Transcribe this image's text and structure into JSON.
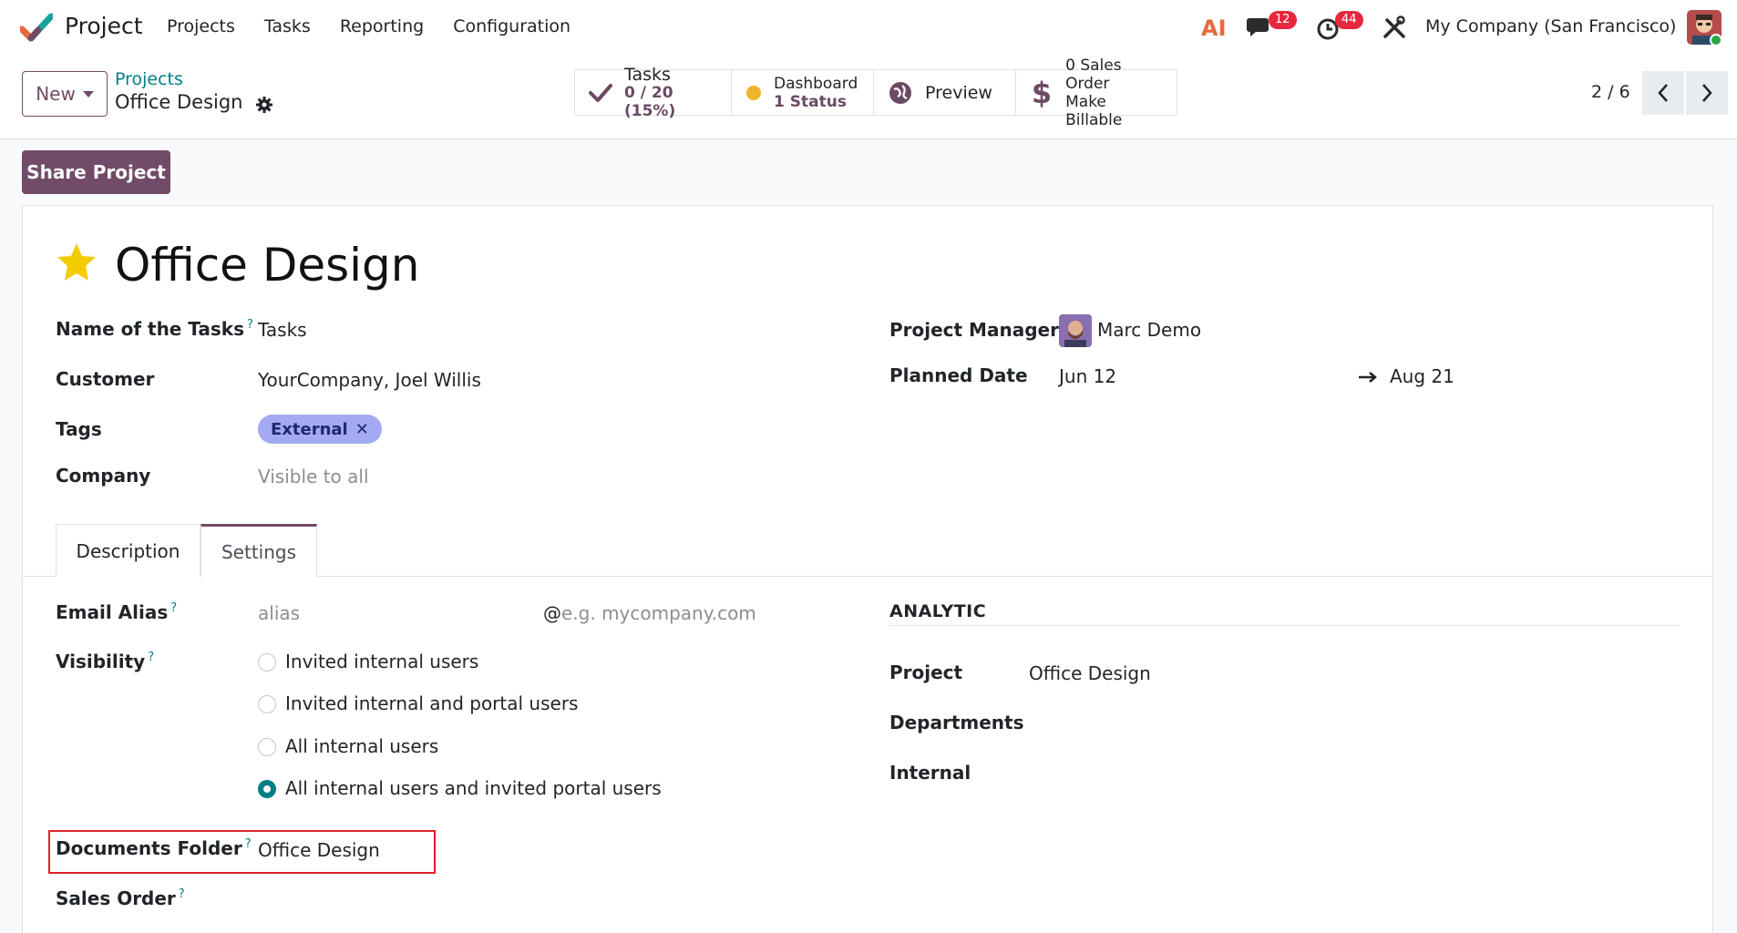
{
  "navbar": {
    "app_name": "Project",
    "menu": [
      "Projects",
      "Tasks",
      "Reporting",
      "Configuration"
    ],
    "ai_label": "AI",
    "messages_count": "12",
    "activities_count": "44",
    "company": "My Company (San Francisco)"
  },
  "control_panel": {
    "new_label": "New",
    "breadcrumb_parent": "Projects",
    "breadcrumb_current": "Office Design",
    "smart_buttons": {
      "tasks_title": "Tasks",
      "tasks_value": "0 / 20 (15%)",
      "dashboard_title": "Dashboard",
      "dashboard_value": "1 Status",
      "preview_title": "Preview",
      "sales_title": "0 Sales Order",
      "sales_value": "Make Billable"
    },
    "pager": "2 / 6"
  },
  "share_button": "Share Project",
  "record": {
    "title": "Office Design",
    "fields": {
      "name_of_tasks_label": "Name of the Tasks",
      "name_of_tasks_value": "Tasks",
      "customer_label": "Customer",
      "customer_value": "YourCompany, Joel Willis",
      "tags_label": "Tags",
      "tag_external": "External",
      "company_label": "Company",
      "company_placeholder": "Visible to all",
      "manager_label": "Project Manager",
      "manager_value": "Marc Demo",
      "planned_label": "Planned Date",
      "planned_start": "Jun 12",
      "planned_end": "Aug 21"
    }
  },
  "tabs": {
    "description": "Description",
    "settings": "Settings"
  },
  "settings": {
    "email_alias_label": "Email Alias",
    "alias_placeholder": "alias",
    "domain_at": "@",
    "domain_placeholder": "e.g. mycompany.com",
    "visibility_label": "Visibility",
    "visibility_options": [
      "Invited internal users",
      "Invited internal and portal users",
      "All internal users",
      "All internal users and invited portal users"
    ],
    "visibility_selected": "All internal users and invited portal users",
    "documents_folder_label": "Documents Folder",
    "documents_folder_value": "Office Design",
    "sales_order_label": "Sales Order",
    "analytic_title": "ANALYTIC",
    "analytic_project_label": "Project",
    "analytic_project_value": "Office Design",
    "departments_label": "Departments",
    "internal_label": "Internal"
  },
  "colors": {
    "brand": "#714b67",
    "link": "#017e84",
    "badge": "#e4293f",
    "tag": "#a3aaf3",
    "star": "#f3cc00",
    "highlight": "#e0202a"
  }
}
